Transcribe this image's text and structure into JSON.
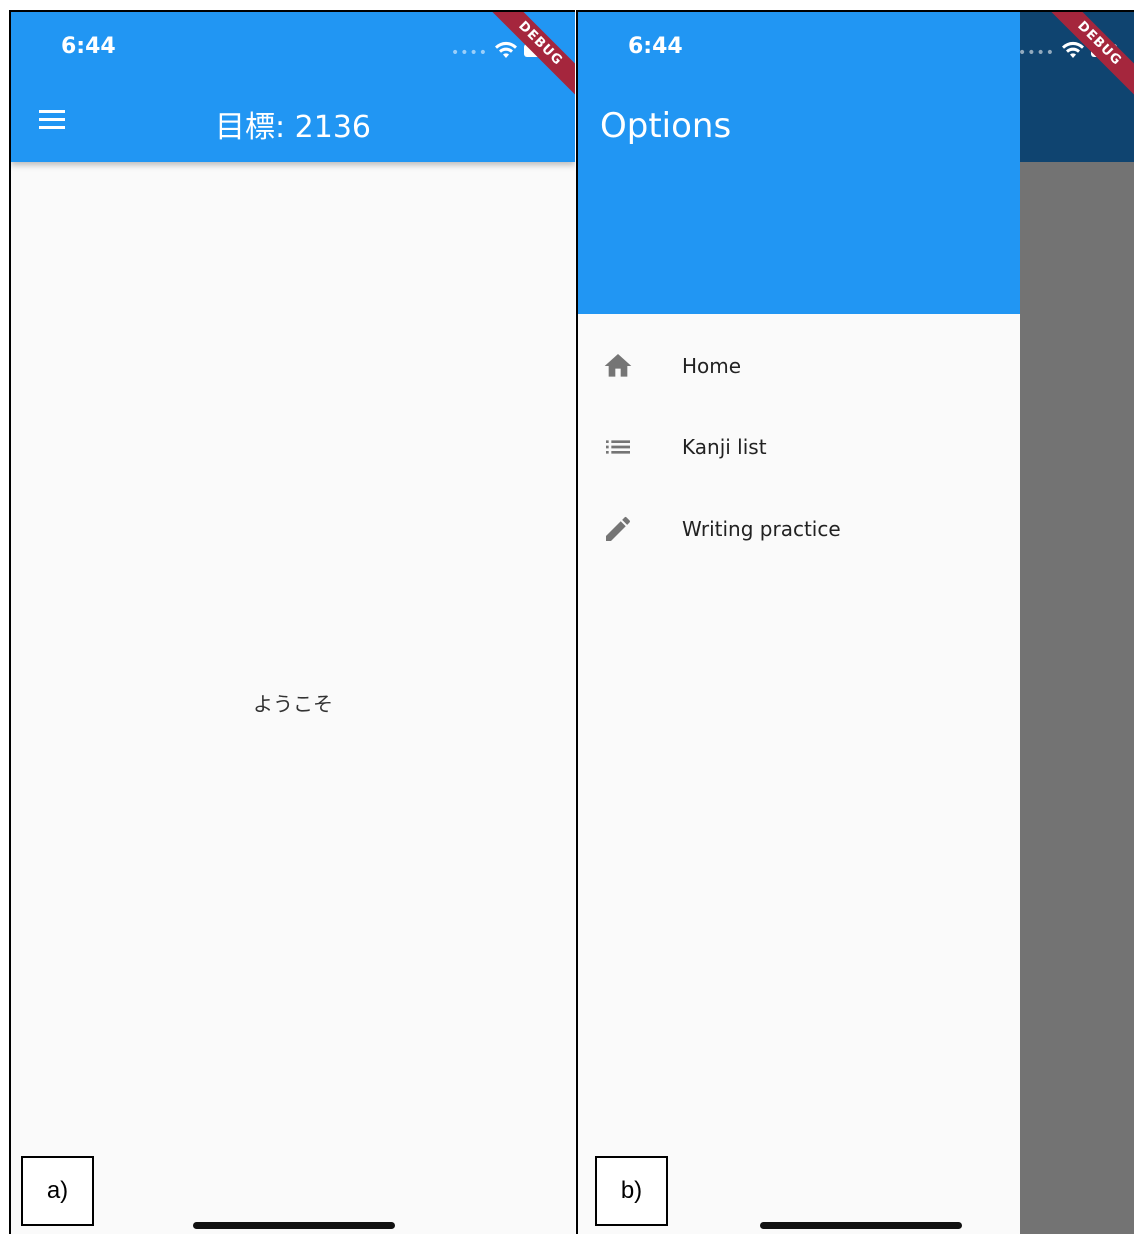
{
  "colors": {
    "primary": "#2196f3",
    "debug": "#a5263d",
    "scrim": "#737373",
    "icon": "#757575"
  },
  "screen_a": {
    "status_time": "6:44",
    "appbar_title": "目標: 2136",
    "center_text": "ようこそ",
    "panel_label": "a)",
    "debug_banner": "DEBUG"
  },
  "screen_b": {
    "status_time": "6:44",
    "drawer_title": "Options",
    "menu_items": [
      {
        "label": "Home",
        "icon": "home-icon"
      },
      {
        "label": "Kanji list",
        "icon": "list-icon"
      },
      {
        "label": "Writing practice",
        "icon": "pencil-icon"
      }
    ],
    "panel_label": "b)",
    "debug_banner": "DEBUG"
  }
}
